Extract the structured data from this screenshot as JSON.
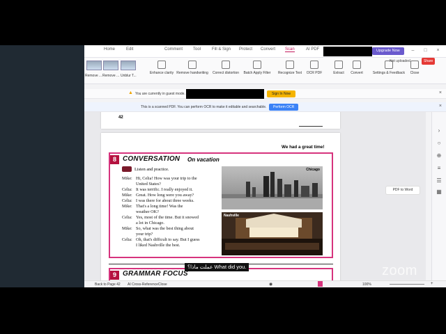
{
  "titlebar": {
    "tabs": [
      "Home",
      "Edit",
      "Comment",
      "Tool",
      "Fill & Sign",
      "Protect",
      "Convert",
      "Scan",
      "AI PDF"
    ],
    "active_tab": "Scan",
    "upgrade_label": "Upgrade Now"
  },
  "ribbon": {
    "thumb_labels": [
      "Remove ...",
      "Remove ...",
      "Unblur T..."
    ],
    "tools": [
      "Enhance clarity",
      "Remove handwriting",
      "Correct distortion",
      "Batch Apply Filter",
      "Recognize Text",
      "OCR PDF",
      "Extract",
      "Convert",
      "Settings & Feedback",
      "Close"
    ],
    "not_uploaded": "Not uploaded",
    "share_label": "Share"
  },
  "notices": {
    "guest_text": "You are currently in guest mode.",
    "signup_label": "Sign In Now",
    "ocr_text": "This is a scanned PDF. You can perform OCR to make it editable and searchable.",
    "ocr_button": "Perform OCR"
  },
  "side": {
    "pdf_to_word": "PDF to Word"
  },
  "page": {
    "page_number": "42",
    "tagline": "We had a great time!",
    "section8_num": "8",
    "section8_title": "CONVERSATION",
    "section8_sub": "On vacation",
    "instruction": "Listen and practice.",
    "photo1_label": "Chicago",
    "photo2_label": "Nashville",
    "dialogue": [
      {
        "speaker": "Mike:",
        "text": "Hi, Celia! How was your trip to the"
      },
      {
        "speaker": "",
        "text": "United States?"
      },
      {
        "speaker": "Celia:",
        "text": "It was terrific. I really enjoyed it."
      },
      {
        "speaker": "Mike:",
        "text": "Great. How long were you away?"
      },
      {
        "speaker": "Celia:",
        "text": "I was there for about three weeks."
      },
      {
        "speaker": "Mike:",
        "text": "That's a long time! Was the"
      },
      {
        "speaker": "",
        "text": "weather OK?"
      },
      {
        "speaker": "Celia:",
        "text": "Yes, most of the time. But it snowed"
      },
      {
        "speaker": "",
        "text": "a lot in Chicago."
      },
      {
        "speaker": "Mike:",
        "text": "So, what was the best thing about"
      },
      {
        "speaker": "",
        "text": "your trip?"
      },
      {
        "speaker": "Celia:",
        "text": "Oh, that's difficult to say. But I guess"
      },
      {
        "speaker": "",
        "text": "I liked Nashville the best."
      }
    ],
    "section9_num": "9",
    "section9_title": "GRAMMAR FOCUS"
  },
  "caption": "عملت ماذا؟ What did you.",
  "status": {
    "back": "Back to Page 42",
    "cross_ref": "AI Cross-ReferenceClose",
    "zoom": "100%"
  },
  "watermark": "zoom"
}
